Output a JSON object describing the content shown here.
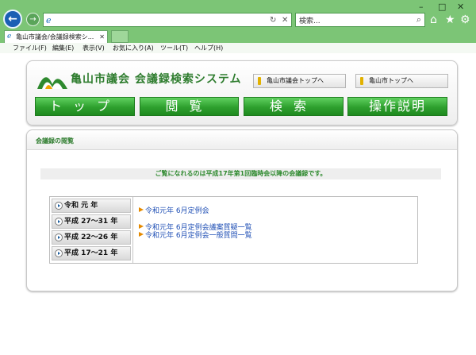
{
  "browser": {
    "search_placeholder": "検索...",
    "tab_title": "亀山市議会/会議録検索シ..."
  },
  "menu": [
    "ファイル(F)",
    "編集(E)",
    "表示(V)",
    "お気に入り(A)",
    "ツール(T)",
    "ヘルプ(H)"
  ],
  "header": {
    "title": "亀山市議会 会議録検索システム",
    "link_council": "亀山市議会トップへ",
    "link_city": "亀山市トップへ",
    "nav": [
      "トップ",
      "閲覧",
      "検索",
      "操作説明"
    ]
  },
  "content": {
    "heading": "会議録の閲覧",
    "notice": "ご覧になれるのは平成17年第1回臨時会以降の会議録です。",
    "years": [
      "令和 元 年",
      "平成 27～31 年",
      "平成 22～26 年",
      "平成 17～21 年"
    ],
    "meetings": [
      "令和元年 6月定例会",
      "令和元年 6月定例会議案質疑一覧",
      "令和元年 6月定例会一般質問一覧"
    ]
  },
  "colors": {
    "chrome": "#7cc576",
    "accent": "#2f7d2f",
    "link": "#1f4fb5"
  }
}
